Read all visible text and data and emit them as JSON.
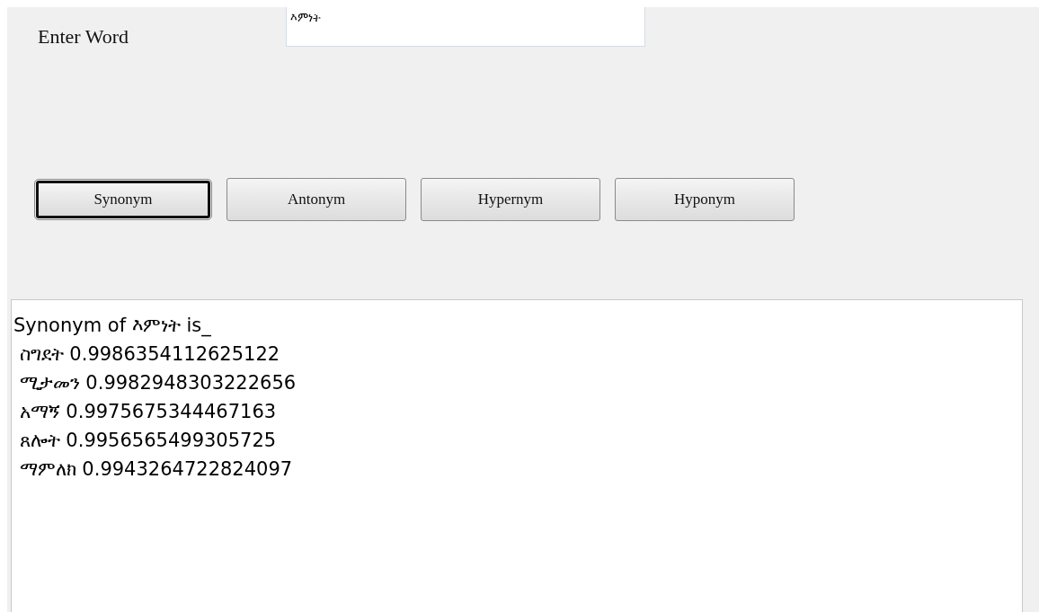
{
  "word_label": "Enter Word",
  "word_field": {
    "value": "እምነት"
  },
  "buttons": [
    {
      "label": "Synonym",
      "selected": true
    },
    {
      "label": "Antonym",
      "selected": false
    },
    {
      "label": "Hypernym",
      "selected": false
    },
    {
      "label": "Hyponym",
      "selected": false
    }
  ],
  "output": {
    "heading": "Synonym of እምነት is_",
    "lines": [
      " ስግደት 0.9986354112625122",
      " ሚታመን 0.9982948303222656",
      " አማኝ 0.9975675344467163",
      " ጸሎት 0.9956565499305725",
      " ማምለክ 0.9943264722824097"
    ]
  }
}
